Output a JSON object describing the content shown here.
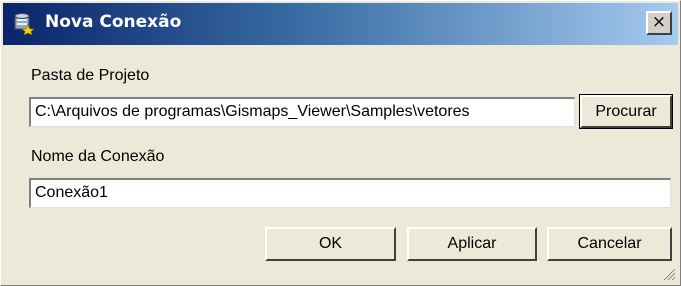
{
  "window": {
    "title": "Nova Conexão",
    "close_label": "×"
  },
  "form": {
    "project_folder_label": "Pasta de Projeto",
    "project_folder_value": "C:\\Arquivos de programas\\Gismaps_Viewer\\Samples\\vetores",
    "browse_label": "Procurar",
    "connection_name_label": "Nome da Conexão",
    "connection_name_value": "Conexão1"
  },
  "buttons": {
    "ok_label": "OK",
    "apply_label": "Aplicar",
    "cancel_label": "Cancelar"
  },
  "icons": {
    "title": "new-connection-icon",
    "close": "close-icon",
    "grip": "resize-grip-icon"
  },
  "colors": {
    "titlebar_start": "#0a246a",
    "titlebar_end": "#a6caf0",
    "window_bg": "#ece9d8"
  }
}
